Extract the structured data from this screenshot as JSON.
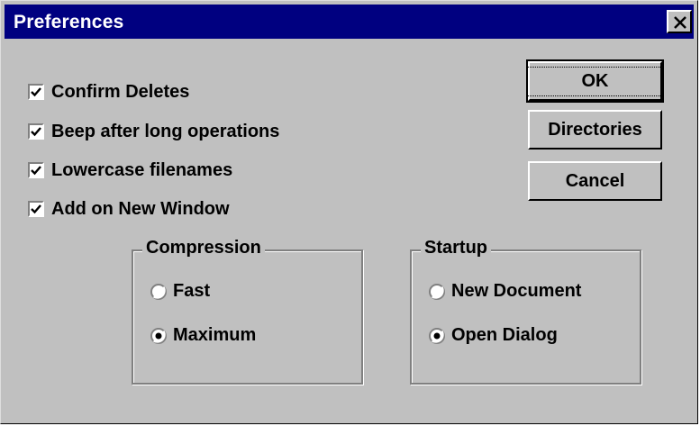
{
  "window": {
    "title": "Preferences",
    "close_glyph": "x-icon"
  },
  "options": [
    {
      "label": "Confirm Deletes",
      "checked": true
    },
    {
      "label": "Beep after long operations",
      "checked": true
    },
    {
      "label": "Lowercase filenames",
      "checked": true
    },
    {
      "label": "Add on New Window",
      "checked": true
    }
  ],
  "buttons": {
    "ok": "OK",
    "directories": "Directories",
    "cancel": "Cancel"
  },
  "compression": {
    "title": "Compression",
    "options": [
      {
        "label": "Fast",
        "selected": false
      },
      {
        "label": "Maximum",
        "selected": true
      }
    ]
  },
  "startup": {
    "title": "Startup",
    "options": [
      {
        "label": "New Document",
        "selected": false
      },
      {
        "label": "Open Dialog",
        "selected": true
      }
    ]
  },
  "colors": {
    "titlebar": "#000080",
    "face": "#c0c0c0"
  }
}
